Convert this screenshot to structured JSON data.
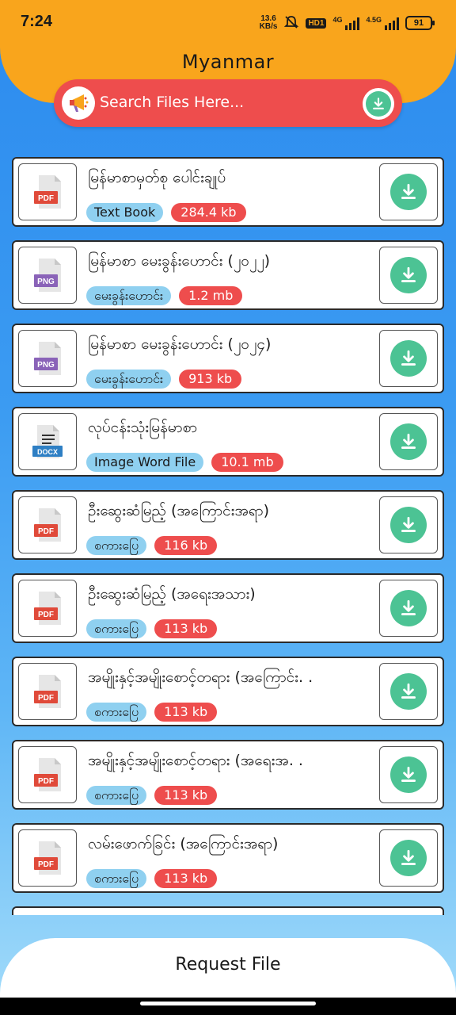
{
  "status": {
    "time": "7:24",
    "net_speed_value": "13.6",
    "net_speed_unit": "KB/s",
    "hd_label": "HD1",
    "signal1_label": "4G",
    "signal2_label": "4.5G",
    "battery": "91"
  },
  "header": {
    "title": "Myanmar"
  },
  "search": {
    "placeholder": "Search Files Here..."
  },
  "items": [
    {
      "title": "မြန်မာစာမှတ်စု ပေါင်းချုပ်",
      "category": "Text Book",
      "size": "284.4 kb",
      "type": "PDF"
    },
    {
      "title": "မြန်မာစာ မေးခွန်းဟောင်း (၂၀၂၂)",
      "category": "မေးခွန်းဟောင်း",
      "size": "1.2 mb",
      "type": "PNG"
    },
    {
      "title": "မြန်မာစာ မေးခွန်းဟောင်း (၂၀၂၄)",
      "category": "မေးခွန်းဟောင်း",
      "size": "913 kb",
      "type": "PNG"
    },
    {
      "title": "လုပ်ငန်းသုံးမြန်မာစာ",
      "category": "Image Word File",
      "size": "10.1 mb",
      "type": "DOCX"
    },
    {
      "title": "ဦးဆွေးဆံမြည့် (အကြောင်းအရာ)",
      "category": "စကားပြေ",
      "size": "116 kb",
      "type": "PDF"
    },
    {
      "title": "ဦးဆွေးဆံမြည့် (အရေးအသား)",
      "category": "စကားပြေ",
      "size": "113 kb",
      "type": "PDF"
    },
    {
      "title": "အမျိုးနှင့်အမျိုးစောင့်တရား (အကြောင်း. .",
      "category": "စကားပြေ",
      "size": "113 kb",
      "type": "PDF"
    },
    {
      "title": "အမျိုးနှင့်အမျိုးစောင့်တရား (အရေးအ. .",
      "category": "စကားပြေ",
      "size": "113 kb",
      "type": "PDF"
    },
    {
      "title": "လမ်းဖောက်ခြင်း (အကြောင်းအရာ)",
      "category": "စကားပြေ",
      "size": "113 kb",
      "type": "PDF"
    }
  ],
  "footer": {
    "request_label": "Request File"
  },
  "colors": {
    "header": "#f9a51c",
    "search_bg": "#ee4d4d",
    "download_green": "#4cc394",
    "category_tag": "#8fd0f0",
    "size_tag": "#ee4d4d",
    "pdf_red": "#e04a3a",
    "png_purple": "#8a63b8",
    "docx_blue": "#2e7fc4"
  },
  "icons": {
    "search_left": "megaphone-icon",
    "search_right": "download-icon",
    "item_action": "download-icon",
    "status": [
      "mute-icon",
      "signal-icon",
      "battery-icon"
    ]
  }
}
